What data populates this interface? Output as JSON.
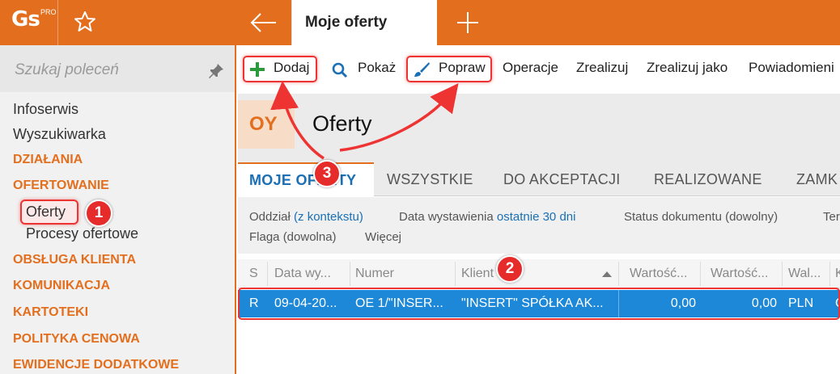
{
  "app": {
    "logo_text": "Gs",
    "logo_badge": "PRO",
    "active_tab": "Moje oferty"
  },
  "sidebar": {
    "search_placeholder": "Szukaj poleceń",
    "items": [
      {
        "label": "Infoserwis",
        "kind": "plain"
      },
      {
        "label": "Wyszukiwarka",
        "kind": "plain"
      },
      {
        "label": "DZIAŁANIA",
        "kind": "category"
      },
      {
        "label": "OFERTOWANIE",
        "kind": "category"
      },
      {
        "label": "Oferty",
        "kind": "sub"
      },
      {
        "label": "Procesy ofertowe",
        "kind": "sub"
      },
      {
        "label": "OBSŁUGA KLIENTA",
        "kind": "category"
      },
      {
        "label": "KOMUNIKACJA",
        "kind": "category"
      },
      {
        "label": "KARTOTEKI",
        "kind": "category"
      },
      {
        "label": "POLITYKA CENOWA",
        "kind": "category"
      },
      {
        "label": "EWIDENCJE DODATKOWE",
        "kind": "category"
      }
    ]
  },
  "toolbar": {
    "add": "Dodaj",
    "show": "Pokaż",
    "edit": "Popraw",
    "operations": "Operacje",
    "realize": "Zrealizuj",
    "realize_as": "Zrealizuj jako",
    "notifications": "Powiadomieni"
  },
  "header": {
    "code": "OY",
    "title": "Oferty"
  },
  "tabs": [
    "MOJE OFERTY",
    "WSZYSTKIE",
    "DO AKCEPTACJI",
    "REALIZOWANE",
    "ZAMK"
  ],
  "filters": {
    "branch_label": "Oddział",
    "branch_value": "(z kontekstu)",
    "date_label": "Data wystawienia",
    "date_value": "ostatnie 30 dni",
    "status": "Status dokumentu (dowolny)",
    "status_cut": "Ter",
    "flag": "Flaga (dowolna)",
    "more": "Więcej"
  },
  "grid": {
    "columns": [
      "S",
      "Data wy...",
      "Numer",
      "Klient",
      "Wartość...",
      "Wartość...",
      "Wal...",
      "K"
    ],
    "rows": [
      {
        "s": "R",
        "date": "09-04-20...",
        "number": "OE 1/\"INSER...",
        "client": "\"INSERT\" SPÓŁKA AK...",
        "value1": "0,00",
        "value2": "0,00",
        "currency": "PLN",
        "extra": "C"
      }
    ]
  },
  "badges": [
    "1",
    "2",
    "3"
  ],
  "colors": {
    "brand": "#e36f1e",
    "accent_blue": "#1a6fb5",
    "selected_row": "#1e88d8",
    "annotation_red": "#e33333"
  }
}
